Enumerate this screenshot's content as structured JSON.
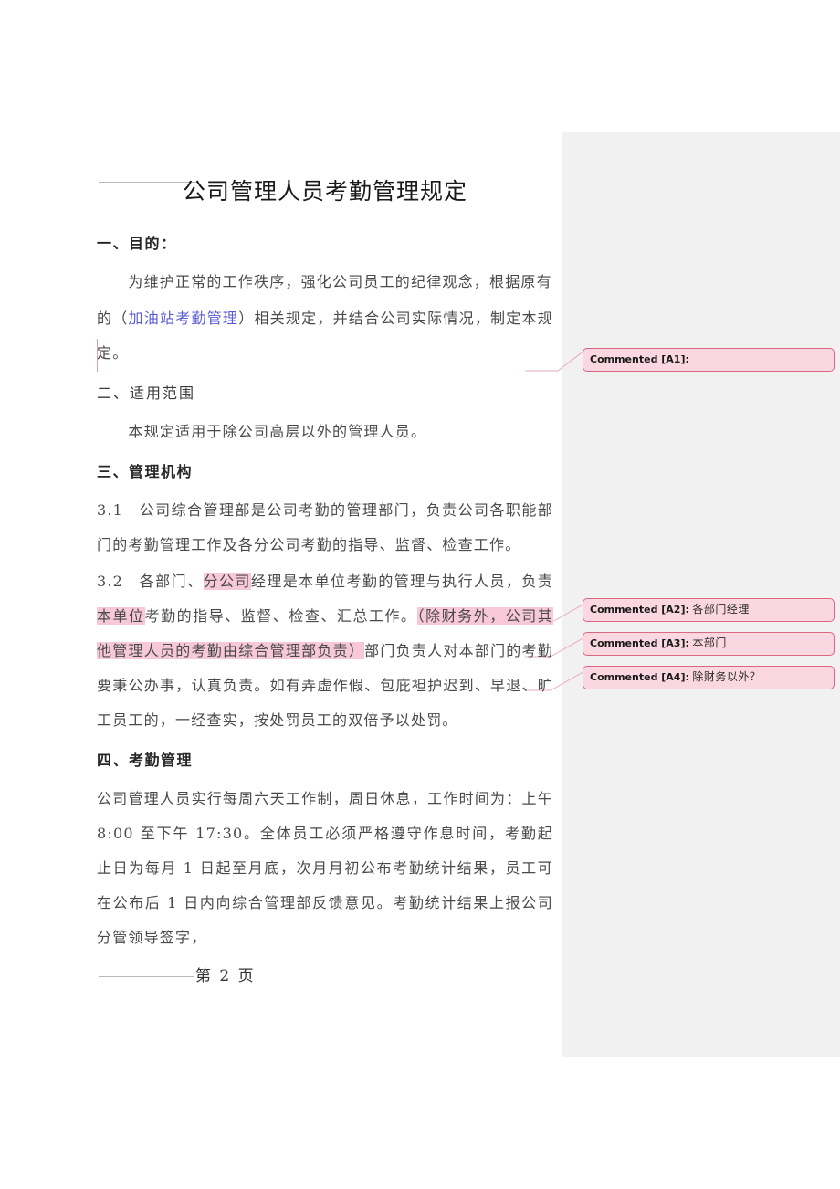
{
  "document": {
    "title": "公司管理人员考勤管理规定",
    "footer": {
      "page_label": "第 2 页"
    },
    "sections": [
      {
        "heading": "一、目的：",
        "paragraphs": [
          "　　为维护正常的工作秩序，强化公司员工的纪律观念，根据原有"
        ],
        "revision_line_prefix": "的（",
        "revision_line_inserted": "加油站考勤管理",
        "revision_line_suffix": "）相关规定，并结合公司实际情况，制定本规定。"
      },
      {
        "heading": "二、适用范围",
        "paragraphs": [
          "　　本规定适用于除公司高层以外的管理人员。"
        ]
      },
      {
        "heading": "三、管理机构",
        "paragraphs": [
          "3.1　公司综合管理部是公司考勤的管理部门，负责公司各职能部门的考勤管理工作及各分公司考勤的指导、监督、检查工作。"
        ]
      },
      {
        "heading": "四、考勤管理",
        "paragraphs": [
          "公司管理人员实行每周六天工作制，周日休息，工作时间为：上午8:00 至下午 17:30。全体员工必须严格遵守作息时间，考勤起止日为每月 1 日起至月底，次月月初公布考勤统计结果，员工可在公布后 1 日内向综合管理部反馈意见。考勤统计结果上报公司分管领导签字，"
        ]
      }
    ],
    "clause_3_2": {
      "prefix": "3.2　各部门、",
      "highlight_1": "分公司",
      "mid_1": "经理是本单位考勤的管理与执行人员，负责",
      "highlight_2": "本单位",
      "mid_2": "考勤的指导、监督、检查、汇总工作。",
      "highlight_3": "（除财务外，公司其他管理人员的考勤由综合管理部负责）",
      "suffix": "部门负责人对本部门的考勤要秉公办事，认真负责。如有弄虚作假、包庇袒护迟到、早退、旷工员工的，一经查实，按处罚员工的双倍予以处罚。"
    }
  },
  "comments": [
    {
      "label": "Commented [A1]:",
      "text": ""
    },
    {
      "label": "Commented [A2]:",
      "text": "各部门经理"
    },
    {
      "label": "Commented [A3]:",
      "text": "本部门"
    },
    {
      "label": "Commented [A4]:",
      "text": "除财务以外？"
    }
  ],
  "colors": {
    "comment_fill": "#fbd7e1",
    "comment_border": "#d9677f",
    "highlight": "#f7c9d8",
    "inserted_text": "#5b5bd6",
    "margin_pane": "#f1f1f1",
    "connector": "#e9a9bd"
  }
}
